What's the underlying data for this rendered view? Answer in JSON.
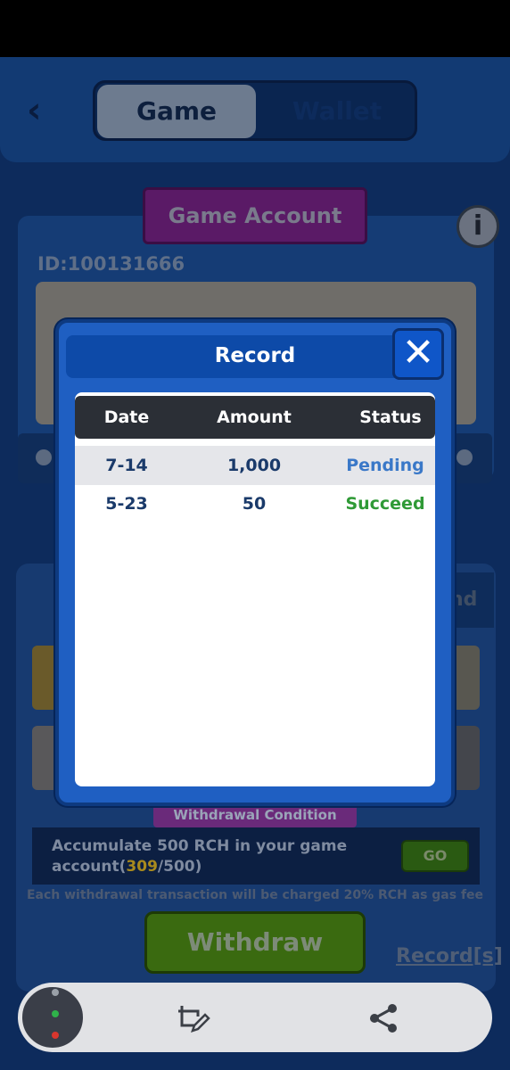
{
  "header": {
    "back_icon": "back-chevron-icon",
    "tabs": [
      {
        "label": "Game",
        "active": true
      },
      {
        "label": "Wallet",
        "active": false
      }
    ]
  },
  "account": {
    "ribbon_title": "Game Account",
    "id_label": "ID:100131666",
    "info_icon": "info-icon"
  },
  "lower": {
    "partial_tab_text": "nd",
    "condition_title": "Withdrawal Condition",
    "condition_prefix": "Accumulate 500 RCH in your game account(",
    "condition_current": "309",
    "condition_suffix": "/500)",
    "go_label": "GO",
    "gas_note": "Each withdrawal transaction will be charged 20% RCH as gas fee",
    "withdraw_label": "Withdraw",
    "record_link": "Record[s]"
  },
  "modal": {
    "title": "Record",
    "close_icon": "close-x-icon",
    "columns": [
      "Date",
      "Amount",
      "Status"
    ],
    "rows": [
      {
        "date": "7-14",
        "amount": "1,000",
        "status": "Pending"
      },
      {
        "date": "5-23",
        "amount": "50",
        "status": "Succeed"
      }
    ]
  },
  "toolbar": {
    "edit_icon": "crop-edit-icon",
    "share_icon": "share-icon"
  },
  "colors": {
    "modal_blue": "#1f5fc2",
    "pending": "#3a78c8",
    "succeed": "#2f9a36",
    "highlight": "#a88a1e"
  }
}
